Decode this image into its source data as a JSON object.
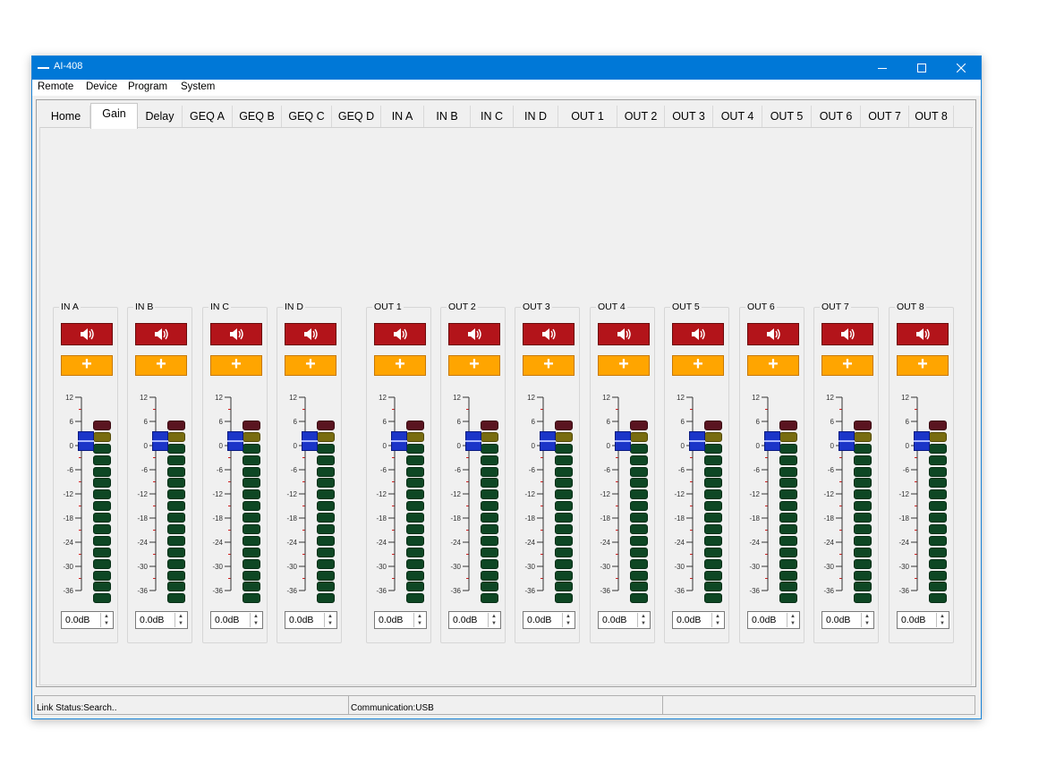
{
  "window": {
    "title": "AI-408"
  },
  "menu": [
    "Remote",
    "Device",
    "Program",
    "System"
  ],
  "tabs": [
    {
      "label": "Home",
      "active": false
    },
    {
      "label": "Gain",
      "active": true
    },
    {
      "label": "Delay",
      "active": false
    },
    {
      "label": "GEQ A",
      "active": false
    },
    {
      "label": "GEQ B",
      "active": false
    },
    {
      "label": "GEQ C",
      "active": false
    },
    {
      "label": "GEQ D",
      "active": false
    },
    {
      "label": "IN A",
      "active": false
    },
    {
      "label": "IN B",
      "active": false
    },
    {
      "label": "IN C",
      "active": false
    },
    {
      "label": "IN D",
      "active": false
    },
    {
      "label": "OUT 1",
      "active": false
    },
    {
      "label": "OUT 2",
      "active": false
    },
    {
      "label": "OUT 3",
      "active": false
    },
    {
      "label": "OUT 4",
      "active": false
    },
    {
      "label": "OUT 5",
      "active": false
    },
    {
      "label": "OUT 6",
      "active": false
    },
    {
      "label": "OUT 7",
      "active": false
    },
    {
      "label": "OUT 8",
      "active": false
    }
  ],
  "scale_labels": [
    "12",
    "6",
    "0",
    "-6",
    "-12",
    "-18",
    "-24",
    "-30",
    "-36"
  ],
  "channels": [
    {
      "name": "IN A",
      "gain": "0.0dB"
    },
    {
      "name": "IN B",
      "gain": "0.0dB"
    },
    {
      "name": "IN C",
      "gain": "0.0dB"
    },
    {
      "name": "IN D",
      "gain": "0.0dB"
    },
    {
      "name": "OUT 1",
      "gain": "0.0dB"
    },
    {
      "name": "OUT 2",
      "gain": "0.0dB"
    },
    {
      "name": "OUT 3",
      "gain": "0.0dB"
    },
    {
      "name": "OUT 4",
      "gain": "0.0dB"
    },
    {
      "name": "OUT 5",
      "gain": "0.0dB"
    },
    {
      "name": "OUT 6",
      "gain": "0.0dB"
    },
    {
      "name": "OUT 7",
      "gain": "0.0dB"
    },
    {
      "name": "OUT 8",
      "gain": "0.0dB"
    }
  ],
  "status": {
    "link": "Link Status:Search..",
    "communication": "Communication:USB",
    "extra": ""
  },
  "colors": {
    "titlebar": "#0078d7",
    "mute_button": "#b3141a",
    "plus_button": "#ffa500",
    "fader": "#1b35c8",
    "meter_green": "#0e4724",
    "meter_olive": "#786c10",
    "meter_red": "#5a1420"
  }
}
